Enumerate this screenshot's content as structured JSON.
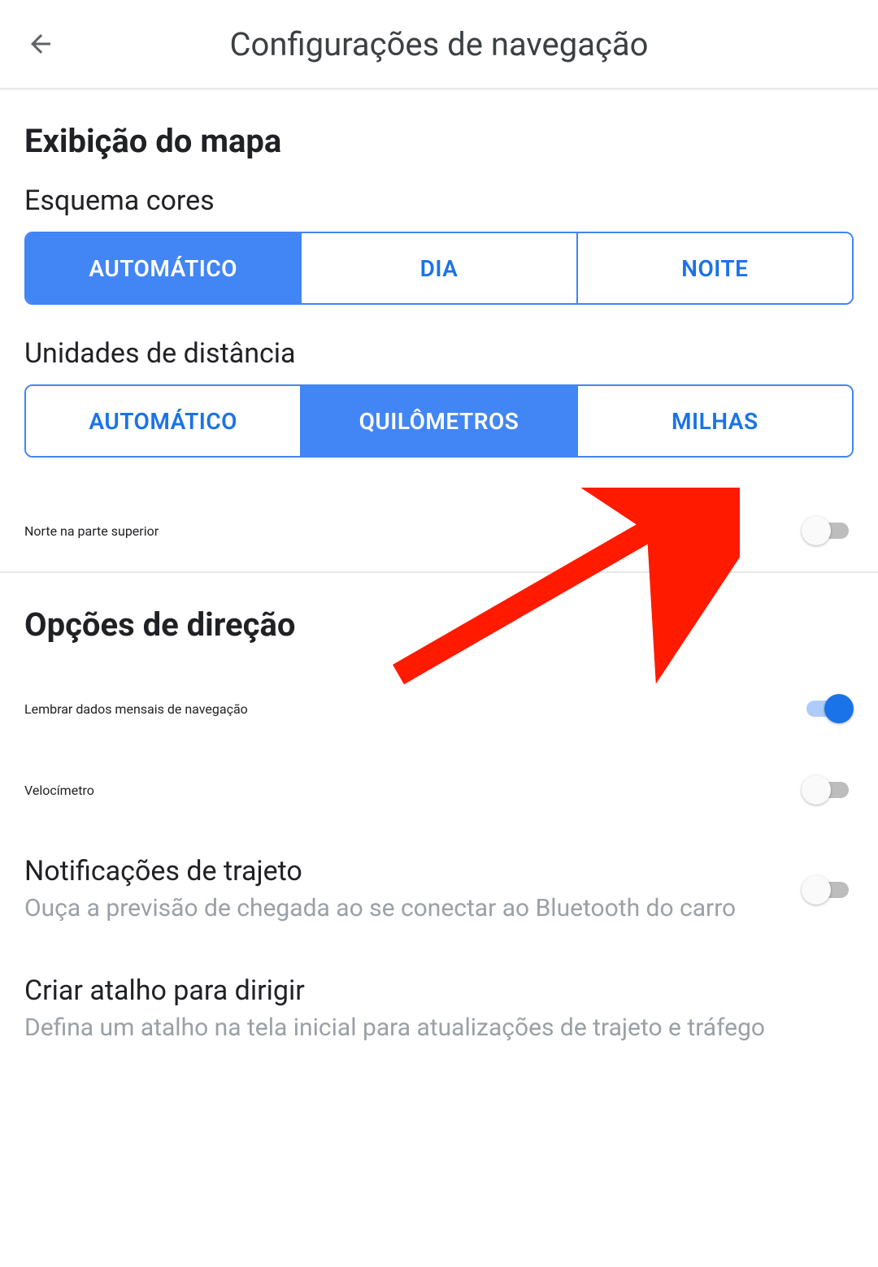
{
  "header": {
    "title": "Configurações de navegação"
  },
  "sections": {
    "map": {
      "title": "Exibição do mapa",
      "color_scheme": {
        "label": "Esquema cores",
        "options": [
          "AUTOMÁTICO",
          "DIA",
          "NOITE"
        ],
        "selected_index": 0
      },
      "distance_units": {
        "label": "Unidades de distância",
        "options": [
          "AUTOMÁTICO",
          "QUILÔMETROS",
          "MILHAS"
        ],
        "selected_index": 1
      },
      "north_up": {
        "label": "Norte na parte superior",
        "on": false
      }
    },
    "driving": {
      "title": "Opções de direção",
      "remember_monthly": {
        "label": "Lembrar dados mensais de navegação",
        "on": true
      },
      "speedometer": {
        "label": "Velocímetro",
        "on": false
      },
      "trip_notifications": {
        "label": "Notificações de trajeto",
        "sub": "Ouça a previsão de chegada ao se conectar ao Bluetooth do carro",
        "on": false
      },
      "driving_shortcut": {
        "label": "Criar atalho para dirigir",
        "sub": "Defina um atalho na tela inicial para atualizações de trajeto e tráfego"
      }
    }
  }
}
